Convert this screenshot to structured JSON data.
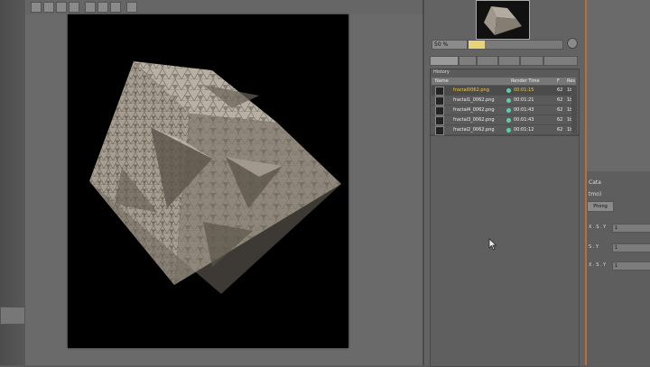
{
  "history": {
    "title": "History",
    "columns": {
      "name": "Name",
      "render_time": "Render Time",
      "f": "F",
      "res": "Res"
    },
    "rows": [
      {
        "name": "fractal0062.png",
        "time": "00:01:15",
        "f": "62",
        "res": "1b"
      },
      {
        "name": "fractal1_0062.png",
        "time": "00:01:21",
        "f": "62",
        "res": "1b"
      },
      {
        "name": "fractal4_0062.png",
        "time": "00:01:43",
        "f": "62",
        "res": "1b"
      },
      {
        "name": "fractal3_0062.png",
        "time": "00:01:43",
        "f": "62",
        "res": "1b"
      },
      {
        "name": "fractal2_0062.png",
        "time": "00:01:12",
        "f": "62",
        "res": "1b"
      }
    ]
  },
  "zoom": {
    "value": "50 %"
  },
  "attributes": {
    "title": "Cata",
    "mode": "tmo)",
    "tab": "Phong",
    "rows": [
      {
        "label": "X . S . Y",
        "value": "1"
      },
      {
        "label": "S . Y",
        "value": "1"
      },
      {
        "label": "X . S . Y",
        "value": "1"
      }
    ]
  },
  "colors": {
    "accent": "#f2c94c",
    "status_dot": "#58d0b0",
    "panel_edge": "#b86d3a"
  }
}
